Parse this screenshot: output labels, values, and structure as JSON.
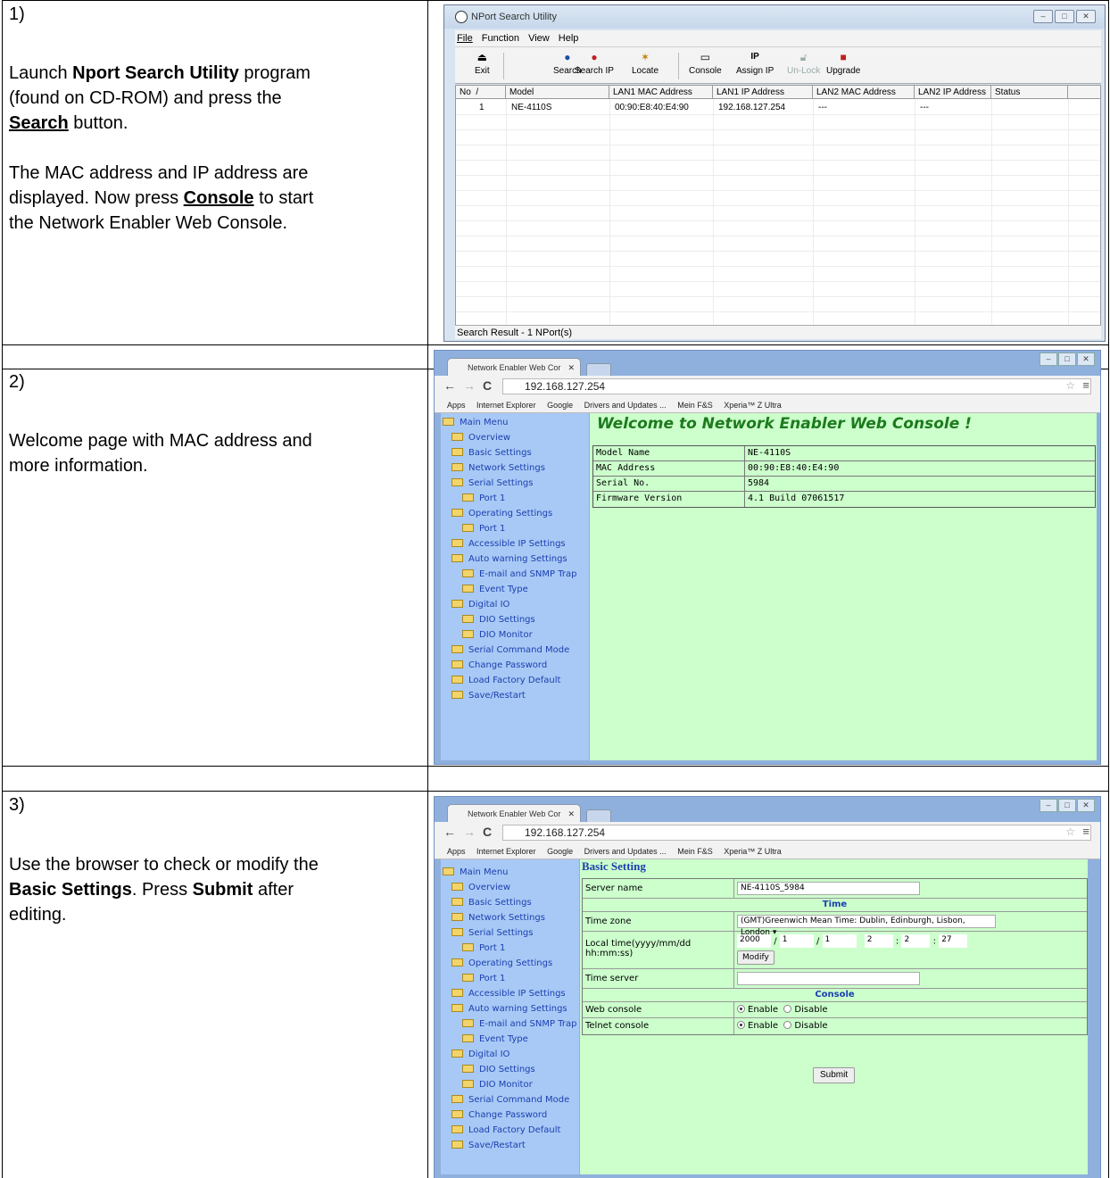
{
  "steps": [
    {
      "number": "1)",
      "l1_pre": "Launch ",
      "l1_b": "Nport Search Utility",
      "l1_post": " program",
      "l2": "(found on CD-ROM) and press the",
      "l3_b": "Search",
      "l3_post": " button.",
      "l4": "The MAC address and IP address are",
      "l5_pre": "displayed. Now press ",
      "l5_b": "Console",
      "l5_post": " to start",
      "l6": "the Network Enabler Web Console."
    },
    {
      "number": "2)",
      "l1": "Welcome page with MAC address and",
      "l2": "more information."
    },
    {
      "number": "3)",
      "l1": "Use the browser to check or modify the",
      "l2_b": "Basic Settings",
      "l2_mid": ". Press ",
      "l2_b2": "Submit",
      "l2_post": " after",
      "l3": "editing."
    }
  ],
  "nport": {
    "title": "NPort Search Utility",
    "menu": [
      "File",
      "Function",
      "View",
      "Help"
    ],
    "toolbar": [
      "Exit",
      "Search",
      "Search IP",
      "Locate",
      "Console",
      "Assign IP",
      "Un-Lock",
      "Upgrade"
    ],
    "columns": [
      "No",
      "/",
      "Model",
      "LAN1 MAC Address",
      "LAN1 IP Address",
      "LAN2 MAC Address",
      "LAN2 IP Address",
      "Status"
    ],
    "row": {
      "no": "1",
      "model": "NE-4110S",
      "mac": "00:90:E8:40:E4:90",
      "ip": "192.168.127.254",
      "mac2": "---",
      "ip2": "---"
    },
    "status": "Search Result - 1 NPort(s)"
  },
  "browser": {
    "tab": "Network Enabler Web Cor",
    "url": "192.168.127.254",
    "bookmarks": [
      "Apps",
      "Internet Explorer",
      "Google",
      "Drivers and Updates ...",
      "Mein F&S",
      "Xperia™ Z Ultra"
    ],
    "menu": [
      "Main Menu",
      "Overview",
      "Basic Settings",
      "Network Settings",
      "Serial Settings",
      "Port 1",
      "Operating Settings",
      "Port 1",
      "Accessible IP Settings",
      "Auto warning Settings",
      "E-mail and SNMP Trap",
      "Event Type",
      "Digital IO",
      "DIO Settings",
      "DIO Monitor",
      "Serial Command Mode",
      "Change Password",
      "Load Factory Default",
      "Save/Restart"
    ]
  },
  "welcome": {
    "title": "Welcome to Network Enabler Web Console !",
    "rows": [
      [
        "Model Name",
        "NE-4110S"
      ],
      [
        "MAC Address",
        "00:90:E8:40:E4:90"
      ],
      [
        "Serial No.",
        "5984"
      ],
      [
        "Firmware Version",
        "4.1 Build 07061517"
      ]
    ]
  },
  "basic": {
    "title": "Basic Setting",
    "server_label": "Server name",
    "server_value": "NE-4110S_5984",
    "time_section": "Time",
    "tz_label": "Time zone",
    "tz_value": "(GMT)Greenwich Mean Time: Dublin, Edinburgh, Lisbon, London",
    "lt_label1": "Local time(yyyy/mm/dd",
    "lt_label2": "hh:mm:ss)",
    "year": "2000",
    "month": "1",
    "day": "1",
    "hour": "2",
    "min": "2",
    "sec": "27",
    "sep_date": "/",
    "sep_time": ":",
    "modify": "Modify",
    "ts_label": "Time server",
    "console_section": "Console",
    "web_label": "Web console",
    "telnet_label": "Telnet console",
    "enable": "Enable",
    "disable": "Disable",
    "submit": "Submit"
  }
}
